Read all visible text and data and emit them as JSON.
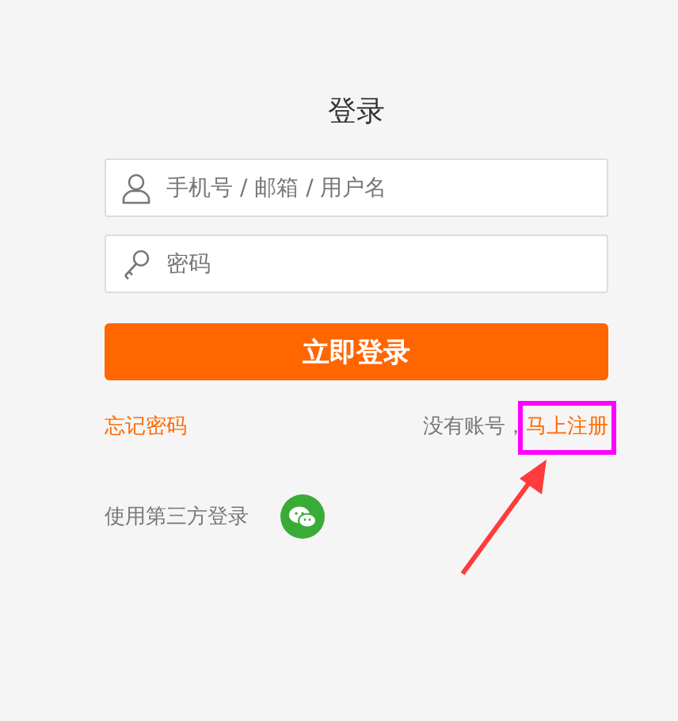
{
  "title": "登录",
  "fields": [
    {
      "kind": "user",
      "placeholder": "手机号 / 邮箱 / 用户名"
    },
    {
      "kind": "password",
      "placeholder": "密码"
    }
  ],
  "login_button": "立即登录",
  "forgot_link": "忘记密码",
  "register_prompt": "没有账号，",
  "register_link": "马上注册",
  "third_party": {
    "label": "使用第三方登录",
    "providers": [
      {
        "kind": "wechat"
      }
    ]
  },
  "register_callout": {
    "highlight_box": true,
    "arrow": true
  }
}
